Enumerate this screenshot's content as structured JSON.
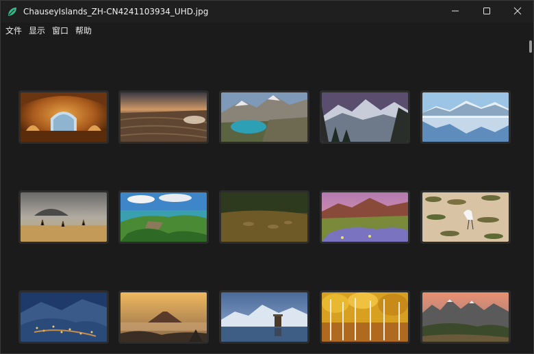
{
  "window": {
    "title": "ChauseyIslands_ZH-CN4241103934_UHD.jpg",
    "controls": {
      "minimize": "minimize-icon",
      "maximize": "maximize-icon",
      "close": "close-icon"
    }
  },
  "menu": [
    {
      "label": "文件"
    },
    {
      "label": "显示"
    },
    {
      "label": "窗口"
    },
    {
      "label": "帮助"
    }
  ],
  "colors": {
    "background": "#1c1b1b",
    "titlebar": "#1f1f1f",
    "app_icon": "#2fbf8f",
    "thumbnail_frame": "#2c2c2c"
  },
  "thumbnails": [
    {
      "row": 1,
      "col": 1,
      "subject": "alhambra-arch"
    },
    {
      "row": 1,
      "col": 2,
      "subject": "sunset-fields"
    },
    {
      "row": 1,
      "col": 3,
      "subject": "mountain-lake"
    },
    {
      "row": 1,
      "col": 4,
      "subject": "snowy-peaks"
    },
    {
      "row": 1,
      "col": 5,
      "subject": "mountain-reflection"
    },
    {
      "row": 2,
      "col": 1,
      "subject": "savanna-giraffes"
    },
    {
      "row": 2,
      "col": 2,
      "subject": "coastal-island"
    },
    {
      "row": 2,
      "col": 3,
      "subject": "grassland-animals"
    },
    {
      "row": 2,
      "col": 4,
      "subject": "wildflower-meadow"
    },
    {
      "row": 2,
      "col": 5,
      "subject": "egret-lily-pads"
    },
    {
      "row": 3,
      "col": 1,
      "subject": "mountain-town-night"
    },
    {
      "row": 3,
      "col": 2,
      "subject": "volcano-sunrise"
    },
    {
      "row": 3,
      "col": 3,
      "subject": "castle-lake"
    },
    {
      "row": 3,
      "col": 4,
      "subject": "autumn-aspens"
    },
    {
      "row": 3,
      "col": 5,
      "subject": "rocky-mountains"
    }
  ]
}
